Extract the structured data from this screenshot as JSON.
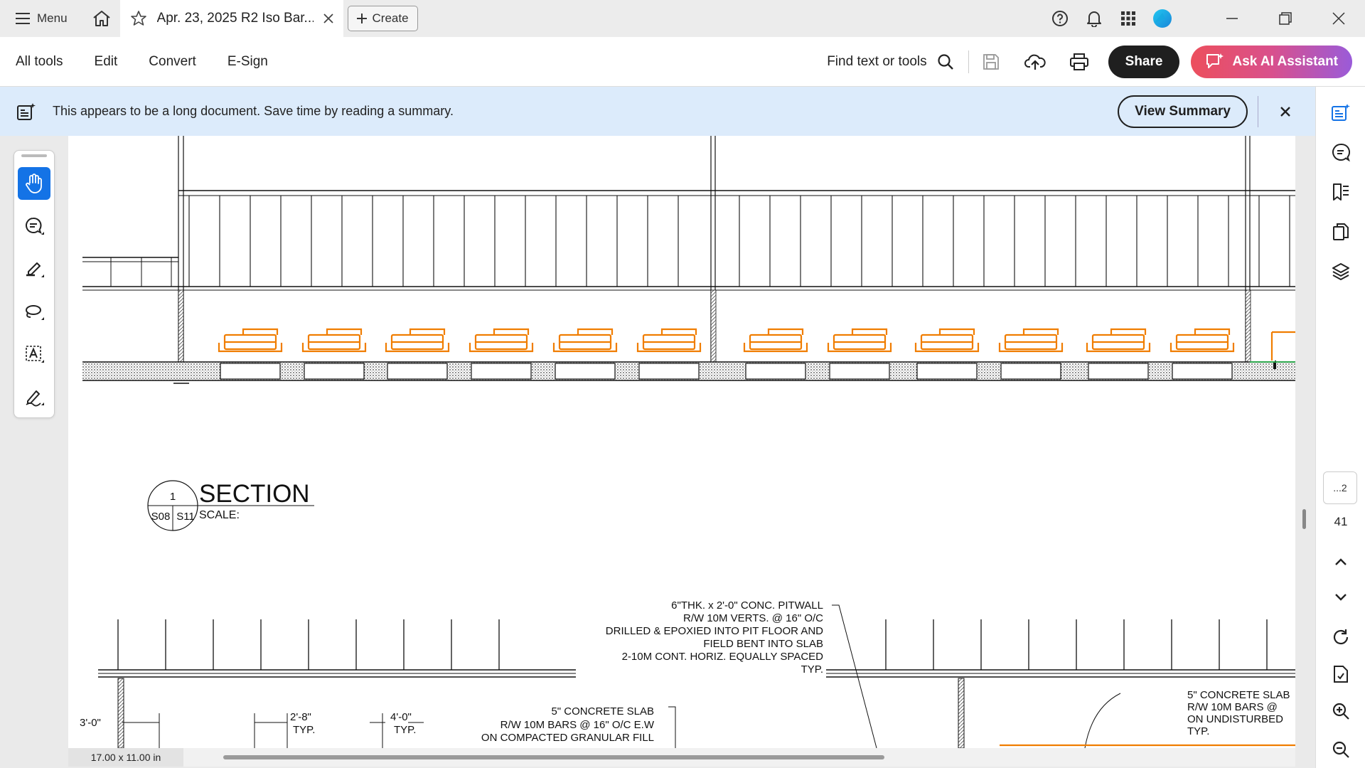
{
  "tabbar": {
    "menu_label": "Menu",
    "doc_tab_title": "Apr. 23, 2025 R2 Iso Bar...",
    "create_label": "Create"
  },
  "toolbar": {
    "nav": [
      "All tools",
      "Edit",
      "Convert",
      "E-Sign"
    ],
    "find_label": "Find text or tools",
    "share_label": "Share",
    "ai_label": "Ask AI Assistant"
  },
  "banner": {
    "text": "This appears to be a long document. Save time by reading a summary.",
    "button_label": "View Summary"
  },
  "page_nav": {
    "current_page": "...2",
    "total_pages": "41"
  },
  "page_size": "17.00 x 11.00 in",
  "drawing": {
    "section_title": "SECTION",
    "section_number": "1",
    "section_sheet_left": "S08",
    "section_sheet_right": "S11",
    "scale_label": "SCALE:",
    "pitwall_note": [
      "6\"THK. x 2'-0\" CONC. PITWALL",
      "R/W 10M VERTS. @ 16\" O/C",
      "DRILLED & EPOXIED INTO PIT FLOOR AND",
      "FIELD BENT INTO SLAB",
      "2-10M CONT. HORIZ. EQUALLY SPACED",
      "TYP."
    ],
    "slab_note_left": [
      "5\" CONCRETE SLAB",
      "R/W 10M BARS @ 16\" O/C E.W",
      "ON COMPACTED GRANULAR FILL"
    ],
    "slab_note_right": [
      "5\" CONCRETE SLAB",
      "R/W 10M BARS @",
      "ON UNDISTURBED",
      "TYP."
    ],
    "dim_3": "3'-0\"",
    "dim_2_8": "2'-8\"",
    "dim_2_8_typ": "TYP.",
    "dim_4_0": "4'-0\"",
    "dim_4_0_typ": "TYP."
  },
  "colors": {
    "accent_blue": "#1473e6",
    "banner_bg": "#dcebfb",
    "drawing_orange": "#f07d00",
    "ai_gradient_start": "#ec4f5d",
    "ai_gradient_end": "#9a5bd9"
  },
  "icons": {
    "tabbar": [
      "hamburger-icon",
      "home-icon",
      "star-icon",
      "close-icon",
      "plus-icon",
      "help-icon",
      "bell-icon",
      "apps-grid-icon",
      "profile-icon",
      "minimize-icon",
      "restore-icon",
      "close-window-icon"
    ],
    "toolbar": [
      "search-icon",
      "save-icon",
      "cloud-upload-icon",
      "print-icon",
      "ai-chat-icon"
    ],
    "left_tools": [
      "hand-icon",
      "comment-icon",
      "highlighter-icon",
      "lasso-icon",
      "text-select-icon",
      "signature-icon"
    ],
    "right_rail": [
      "summary-icon",
      "comments-panel-icon",
      "bookmarks-icon",
      "pages-icon",
      "layers-icon",
      "chevron-up-icon",
      "chevron-down-icon",
      "rotate-icon",
      "file-info-icon",
      "zoom-in-icon",
      "zoom-out-icon"
    ]
  }
}
